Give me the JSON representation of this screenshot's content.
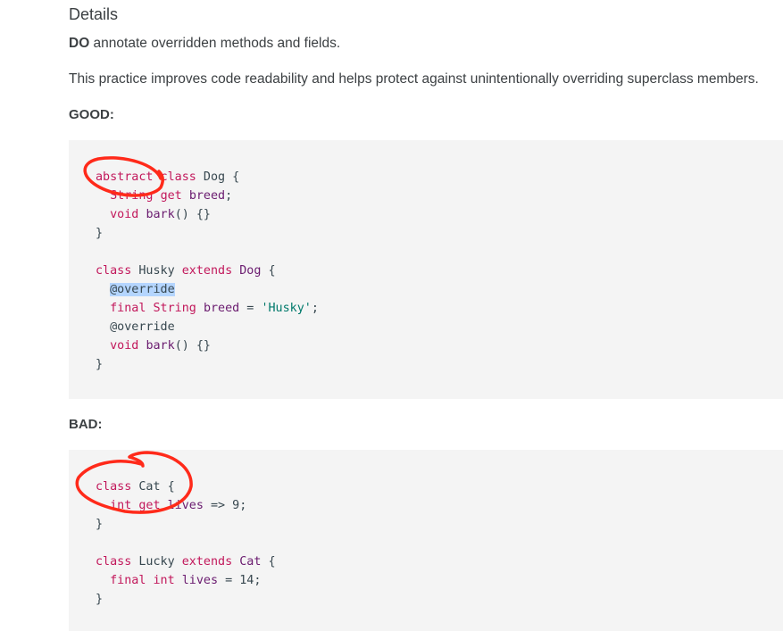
{
  "heading": "Details",
  "rule": {
    "strong": "DO",
    "text": " annotate overridden methods and fields."
  },
  "description": "This practice improves code readability and helps protect against unintentionally overriding superclass members.",
  "good": {
    "label": "GOOD:",
    "lines": [
      [
        {
          "t": "kw",
          "v": "abstract"
        },
        {
          "t": "pl",
          "v": " "
        },
        {
          "t": "kw",
          "v": "class"
        },
        {
          "t": "pl",
          "v": " Dog {"
        }
      ],
      [
        {
          "t": "pl",
          "v": "  "
        },
        {
          "t": "kw",
          "v": "String"
        },
        {
          "t": "pl",
          "v": " "
        },
        {
          "t": "kw",
          "v": "get"
        },
        {
          "t": "pl",
          "v": " "
        },
        {
          "t": "id",
          "v": "breed"
        },
        {
          "t": "pl",
          "v": ";"
        }
      ],
      [
        {
          "t": "pl",
          "v": "  "
        },
        {
          "t": "kw",
          "v": "void"
        },
        {
          "t": "pl",
          "v": " "
        },
        {
          "t": "id",
          "v": "bark"
        },
        {
          "t": "pl",
          "v": "() {}"
        }
      ],
      [
        {
          "t": "pl",
          "v": "}"
        }
      ],
      [
        {
          "t": "pl",
          "v": ""
        }
      ],
      [
        {
          "t": "kw",
          "v": "class"
        },
        {
          "t": "pl",
          "v": " Husky "
        },
        {
          "t": "kw",
          "v": "extends"
        },
        {
          "t": "pl",
          "v": " "
        },
        {
          "t": "id",
          "v": "Dog"
        },
        {
          "t": "pl",
          "v": " {"
        }
      ],
      [
        {
          "t": "pl",
          "v": "  "
        },
        {
          "t": "hl",
          "v": "@override"
        }
      ],
      [
        {
          "t": "pl",
          "v": "  "
        },
        {
          "t": "kw",
          "v": "final"
        },
        {
          "t": "pl",
          "v": " "
        },
        {
          "t": "kw",
          "v": "String"
        },
        {
          "t": "pl",
          "v": " "
        },
        {
          "t": "id",
          "v": "breed"
        },
        {
          "t": "pl",
          "v": " = "
        },
        {
          "t": "str",
          "v": "'Husky'"
        },
        {
          "t": "pl",
          "v": ";"
        }
      ],
      [
        {
          "t": "pl",
          "v": "  @override"
        }
      ],
      [
        {
          "t": "pl",
          "v": "  "
        },
        {
          "t": "kw",
          "v": "void"
        },
        {
          "t": "pl",
          "v": " "
        },
        {
          "t": "id",
          "v": "bark"
        },
        {
          "t": "pl",
          "v": "() {}"
        }
      ],
      [
        {
          "t": "pl",
          "v": "}"
        }
      ]
    ]
  },
  "bad": {
    "label": "BAD:",
    "lines": [
      [
        {
          "t": "kw",
          "v": "class"
        },
        {
          "t": "pl",
          "v": " Cat {"
        }
      ],
      [
        {
          "t": "pl",
          "v": "  "
        },
        {
          "t": "kw",
          "v": "int"
        },
        {
          "t": "pl",
          "v": " "
        },
        {
          "t": "kw",
          "v": "get"
        },
        {
          "t": "pl",
          "v": " "
        },
        {
          "t": "id",
          "v": "lives"
        },
        {
          "t": "pl",
          "v": " => 9;"
        }
      ],
      [
        {
          "t": "pl",
          "v": "}"
        }
      ],
      [
        {
          "t": "pl",
          "v": ""
        }
      ],
      [
        {
          "t": "kw",
          "v": "class"
        },
        {
          "t": "pl",
          "v": " Lucky "
        },
        {
          "t": "kw",
          "v": "extends"
        },
        {
          "t": "pl",
          "v": " "
        },
        {
          "t": "id",
          "v": "Cat"
        },
        {
          "t": "pl",
          "v": " {"
        }
      ],
      [
        {
          "t": "pl",
          "v": "  "
        },
        {
          "t": "kw",
          "v": "final"
        },
        {
          "t": "pl",
          "v": " "
        },
        {
          "t": "kw",
          "v": "int"
        },
        {
          "t": "pl",
          "v": " "
        },
        {
          "t": "id",
          "v": "lives"
        },
        {
          "t": "pl",
          "v": " = 14;"
        }
      ],
      [
        {
          "t": "pl",
          "v": "}"
        }
      ]
    ]
  },
  "annotations": {
    "color": "#ff2a1a",
    "marks": [
      "circle-around-abstract",
      "circle-around-class-cat"
    ]
  },
  "syntax_colors": {
    "keyword": "#c2185b",
    "identifier": "#6a1b6f",
    "string": "#00796b",
    "plain": "#37474f",
    "highlight": "#b4d5fe"
  }
}
